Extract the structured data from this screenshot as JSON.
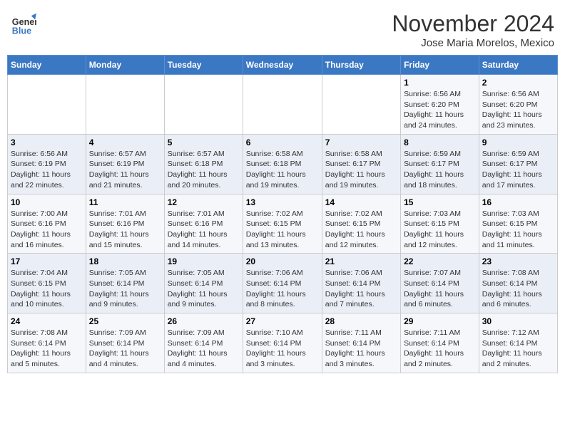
{
  "logo": {
    "line1": "General",
    "line2": "Blue"
  },
  "title": "November 2024",
  "location": "Jose Maria Morelos, Mexico",
  "days_of_week": [
    "Sunday",
    "Monday",
    "Tuesday",
    "Wednesday",
    "Thursday",
    "Friday",
    "Saturday"
  ],
  "weeks": [
    [
      {
        "day": "",
        "info": ""
      },
      {
        "day": "",
        "info": ""
      },
      {
        "day": "",
        "info": ""
      },
      {
        "day": "",
        "info": ""
      },
      {
        "day": "",
        "info": ""
      },
      {
        "day": "1",
        "info": "Sunrise: 6:56 AM\nSunset: 6:20 PM\nDaylight: 11 hours and 24 minutes."
      },
      {
        "day": "2",
        "info": "Sunrise: 6:56 AM\nSunset: 6:20 PM\nDaylight: 11 hours and 23 minutes."
      }
    ],
    [
      {
        "day": "3",
        "info": "Sunrise: 6:56 AM\nSunset: 6:19 PM\nDaylight: 11 hours and 22 minutes."
      },
      {
        "day": "4",
        "info": "Sunrise: 6:57 AM\nSunset: 6:19 PM\nDaylight: 11 hours and 21 minutes."
      },
      {
        "day": "5",
        "info": "Sunrise: 6:57 AM\nSunset: 6:18 PM\nDaylight: 11 hours and 20 minutes."
      },
      {
        "day": "6",
        "info": "Sunrise: 6:58 AM\nSunset: 6:18 PM\nDaylight: 11 hours and 19 minutes."
      },
      {
        "day": "7",
        "info": "Sunrise: 6:58 AM\nSunset: 6:17 PM\nDaylight: 11 hours and 19 minutes."
      },
      {
        "day": "8",
        "info": "Sunrise: 6:59 AM\nSunset: 6:17 PM\nDaylight: 11 hours and 18 minutes."
      },
      {
        "day": "9",
        "info": "Sunrise: 6:59 AM\nSunset: 6:17 PM\nDaylight: 11 hours and 17 minutes."
      }
    ],
    [
      {
        "day": "10",
        "info": "Sunrise: 7:00 AM\nSunset: 6:16 PM\nDaylight: 11 hours and 16 minutes."
      },
      {
        "day": "11",
        "info": "Sunrise: 7:01 AM\nSunset: 6:16 PM\nDaylight: 11 hours and 15 minutes."
      },
      {
        "day": "12",
        "info": "Sunrise: 7:01 AM\nSunset: 6:16 PM\nDaylight: 11 hours and 14 minutes."
      },
      {
        "day": "13",
        "info": "Sunrise: 7:02 AM\nSunset: 6:15 PM\nDaylight: 11 hours and 13 minutes."
      },
      {
        "day": "14",
        "info": "Sunrise: 7:02 AM\nSunset: 6:15 PM\nDaylight: 11 hours and 12 minutes."
      },
      {
        "day": "15",
        "info": "Sunrise: 7:03 AM\nSunset: 6:15 PM\nDaylight: 11 hours and 12 minutes."
      },
      {
        "day": "16",
        "info": "Sunrise: 7:03 AM\nSunset: 6:15 PM\nDaylight: 11 hours and 11 minutes."
      }
    ],
    [
      {
        "day": "17",
        "info": "Sunrise: 7:04 AM\nSunset: 6:15 PM\nDaylight: 11 hours and 10 minutes."
      },
      {
        "day": "18",
        "info": "Sunrise: 7:05 AM\nSunset: 6:14 PM\nDaylight: 11 hours and 9 minutes."
      },
      {
        "day": "19",
        "info": "Sunrise: 7:05 AM\nSunset: 6:14 PM\nDaylight: 11 hours and 9 minutes."
      },
      {
        "day": "20",
        "info": "Sunrise: 7:06 AM\nSunset: 6:14 PM\nDaylight: 11 hours and 8 minutes."
      },
      {
        "day": "21",
        "info": "Sunrise: 7:06 AM\nSunset: 6:14 PM\nDaylight: 11 hours and 7 minutes."
      },
      {
        "day": "22",
        "info": "Sunrise: 7:07 AM\nSunset: 6:14 PM\nDaylight: 11 hours and 6 minutes."
      },
      {
        "day": "23",
        "info": "Sunrise: 7:08 AM\nSunset: 6:14 PM\nDaylight: 11 hours and 6 minutes."
      }
    ],
    [
      {
        "day": "24",
        "info": "Sunrise: 7:08 AM\nSunset: 6:14 PM\nDaylight: 11 hours and 5 minutes."
      },
      {
        "day": "25",
        "info": "Sunrise: 7:09 AM\nSunset: 6:14 PM\nDaylight: 11 hours and 4 minutes."
      },
      {
        "day": "26",
        "info": "Sunrise: 7:09 AM\nSunset: 6:14 PM\nDaylight: 11 hours and 4 minutes."
      },
      {
        "day": "27",
        "info": "Sunrise: 7:10 AM\nSunset: 6:14 PM\nDaylight: 11 hours and 3 minutes."
      },
      {
        "day": "28",
        "info": "Sunrise: 7:11 AM\nSunset: 6:14 PM\nDaylight: 11 hours and 3 minutes."
      },
      {
        "day": "29",
        "info": "Sunrise: 7:11 AM\nSunset: 6:14 PM\nDaylight: 11 hours and 2 minutes."
      },
      {
        "day": "30",
        "info": "Sunrise: 7:12 AM\nSunset: 6:14 PM\nDaylight: 11 hours and 2 minutes."
      }
    ]
  ]
}
